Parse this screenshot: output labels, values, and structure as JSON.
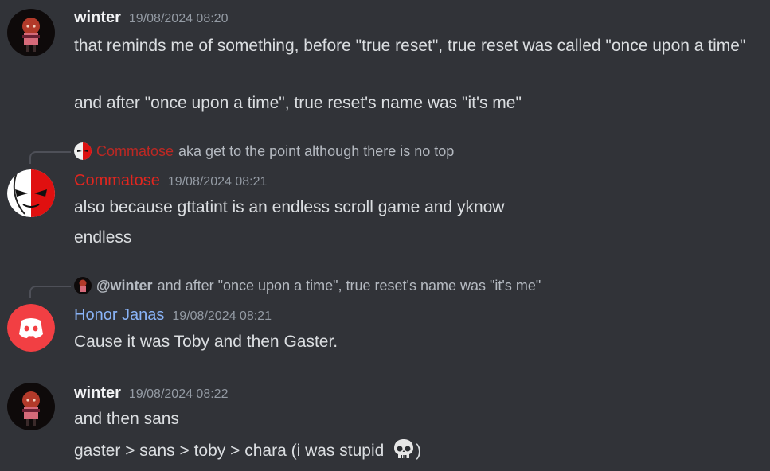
{
  "messages": [
    {
      "author": "winter",
      "timestamp": "19/08/2024 08:20",
      "lines": [
        "that reminds me of something, before \"true reset\", true reset was called \"once upon a time\"",
        "and after \"once upon a time\", true reset's name was \"it's me\""
      ]
    },
    {
      "reply": {
        "author": "Commatose",
        "text": "aka get to the point although there is no top"
      },
      "author": "Commatose",
      "author_color": "#e0261f",
      "timestamp": "19/08/2024 08:21",
      "lines": [
        "also because gttatint is an endless scroll game and yknow",
        "endless"
      ]
    },
    {
      "reply": {
        "author": "@winter",
        "text": "and after \"once upon a time\", true reset's name was \"it's me\""
      },
      "author": "Honor Janas",
      "author_color": "#8ab4f8",
      "timestamp": "19/08/2024 08:21",
      "lines": [
        "Cause it was Toby and then Gaster."
      ]
    },
    {
      "author": "winter",
      "timestamp": "19/08/2024 08:22",
      "lines": [
        "and then sans",
        "gaster > sans > toby > chara (i was stupid ",
        ")"
      ],
      "emoji": "skull-emoji"
    }
  ]
}
